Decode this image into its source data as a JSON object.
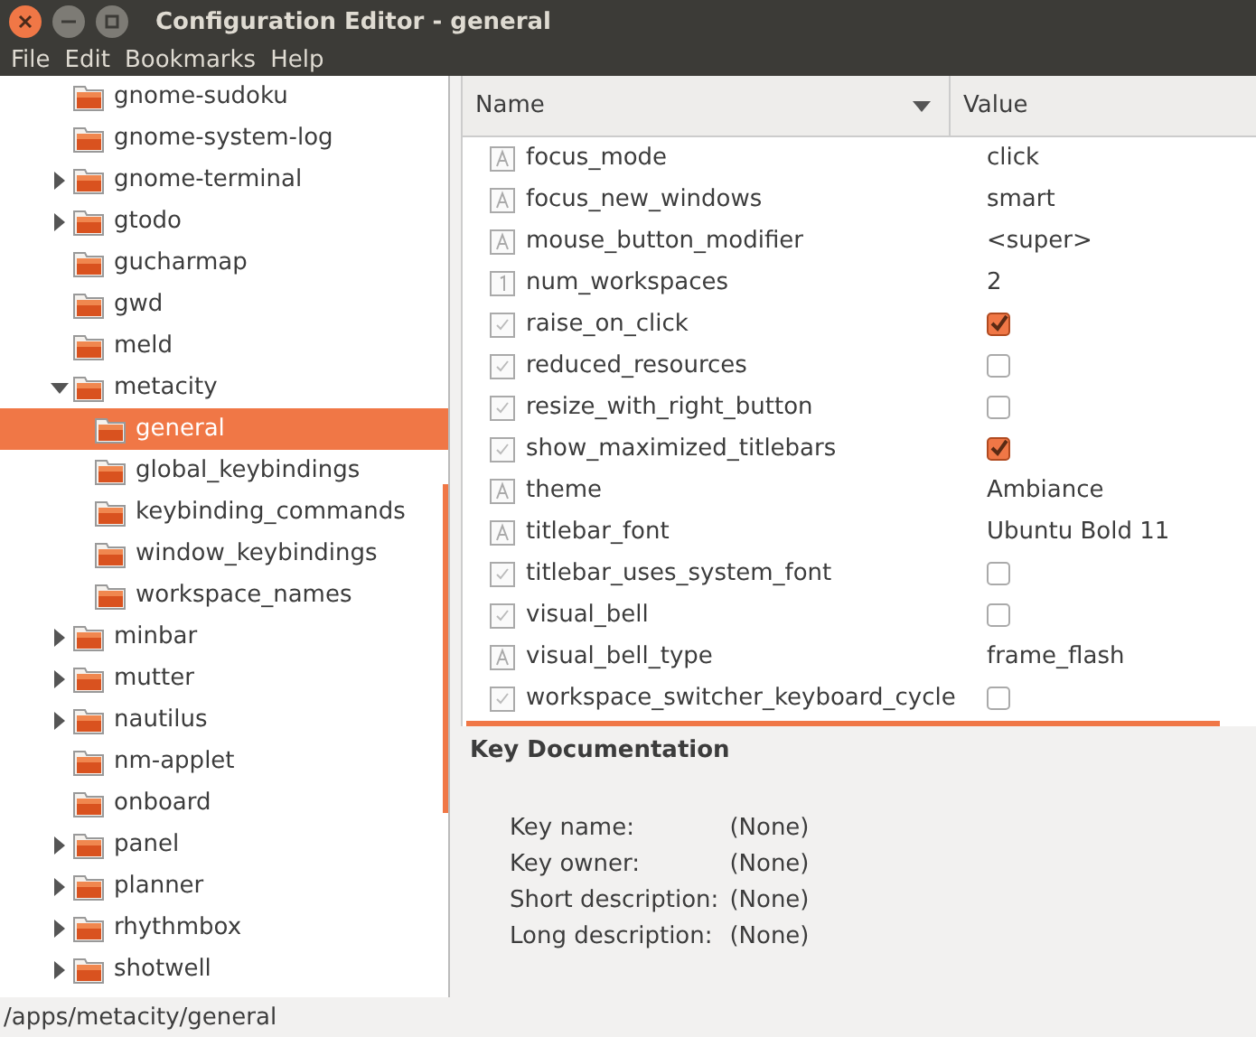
{
  "window": {
    "title": "Configuration Editor - general"
  },
  "menu": [
    "File",
    "Edit",
    "Bookmarks",
    "Help"
  ],
  "tree": [
    {
      "label": "gnome-sudoku",
      "selected": false
    },
    {
      "label": "gnome-system-log",
      "selected": false
    },
    {
      "label": "gnome-terminal",
      "expanded": false,
      "selected": false
    },
    {
      "label": "gtodo",
      "expanded": false,
      "selected": false
    },
    {
      "label": "gucharmap",
      "selected": false
    },
    {
      "label": "gwd",
      "selected": false
    },
    {
      "label": "meld",
      "selected": false
    },
    {
      "label": "metacity",
      "expanded": true,
      "selected": false,
      "children": [
        {
          "label": "general",
          "selected": true
        },
        {
          "label": "global_keybindings",
          "selected": false
        },
        {
          "label": "keybinding_commands",
          "selected": false
        },
        {
          "label": "window_keybindings",
          "selected": false
        },
        {
          "label": "workspace_names",
          "selected": false
        }
      ]
    },
    {
      "label": "minbar",
      "expanded": false,
      "selected": false
    },
    {
      "label": "mutter",
      "expanded": false,
      "selected": false
    },
    {
      "label": "nautilus",
      "expanded": false,
      "selected": false
    },
    {
      "label": "nm-applet",
      "selected": false
    },
    {
      "label": "onboard",
      "selected": false
    },
    {
      "label": "panel",
      "expanded": false,
      "selected": false
    },
    {
      "label": "planner",
      "expanded": false,
      "selected": false
    },
    {
      "label": "rhythmbox",
      "expanded": false,
      "selected": false
    },
    {
      "label": "shotwell",
      "expanded": false,
      "selected": false
    }
  ],
  "table": {
    "columns": [
      "Name",
      "Value"
    ],
    "rows": [
      {
        "kind": "string",
        "name": "focus_mode",
        "value": "click"
      },
      {
        "kind": "string",
        "name": "focus_new_windows",
        "value": "smart"
      },
      {
        "kind": "string",
        "name": "mouse_button_modifier",
        "value": "<super>"
      },
      {
        "kind": "int",
        "name": "num_workspaces",
        "value": "2"
      },
      {
        "kind": "bool",
        "name": "raise_on_click",
        "checked": true
      },
      {
        "kind": "bool",
        "name": "reduced_resources",
        "checked": false
      },
      {
        "kind": "bool",
        "name": "resize_with_right_button",
        "checked": false
      },
      {
        "kind": "bool",
        "name": "show_maximized_titlebars",
        "checked": true
      },
      {
        "kind": "string",
        "name": "theme",
        "value": "Ambiance"
      },
      {
        "kind": "string",
        "name": "titlebar_font",
        "value": "Ubuntu Bold 11"
      },
      {
        "kind": "bool",
        "name": "titlebar_uses_system_font",
        "checked": false
      },
      {
        "kind": "bool",
        "name": "visual_bell",
        "checked": false
      },
      {
        "kind": "string",
        "name": "visual_bell_type",
        "value": "frame_flash"
      },
      {
        "kind": "bool",
        "name": "workspace_switcher_keyboard_cycle",
        "checked": false
      }
    ]
  },
  "documentation": {
    "title": "Key Documentation",
    "fields": [
      {
        "label": "Key name:",
        "value": "(None)"
      },
      {
        "label": "Key owner:",
        "value": "(None)"
      },
      {
        "label": "Short description:",
        "value": "(None)"
      },
      {
        "label": "Long description:",
        "value": "(None)"
      }
    ]
  },
  "status_bar": "/apps/metacity/general"
}
